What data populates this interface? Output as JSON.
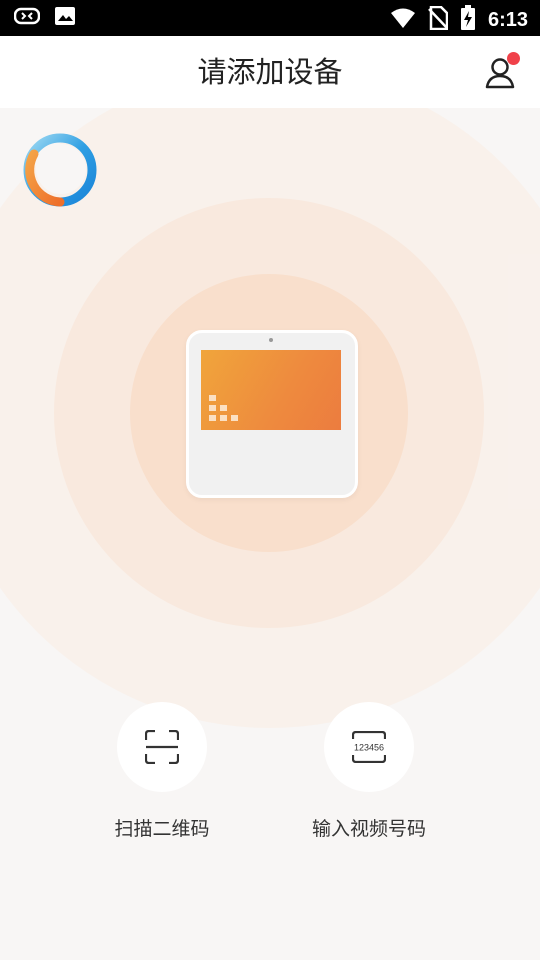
{
  "status_bar": {
    "time": "6:13",
    "icons": [
      "notification-icon",
      "image-icon",
      "wifi-icon",
      "no-sim-icon",
      "battery-charging-icon"
    ]
  },
  "header": {
    "title": "请添加设备",
    "profile_icon": "user-icon",
    "has_notification_dot": true
  },
  "main": {
    "loading_icon": "loading-ring-icon",
    "device_illustration": "smart-display-icon",
    "actions": [
      {
        "label": "扫描二维码",
        "icon": "scan-qr-icon"
      },
      {
        "label": "输入视频号码",
        "icon": "number-input-icon",
        "icon_text": "123456"
      }
    ]
  },
  "colors": {
    "accent": "#ee8a3e",
    "badge": "#f0414a"
  }
}
